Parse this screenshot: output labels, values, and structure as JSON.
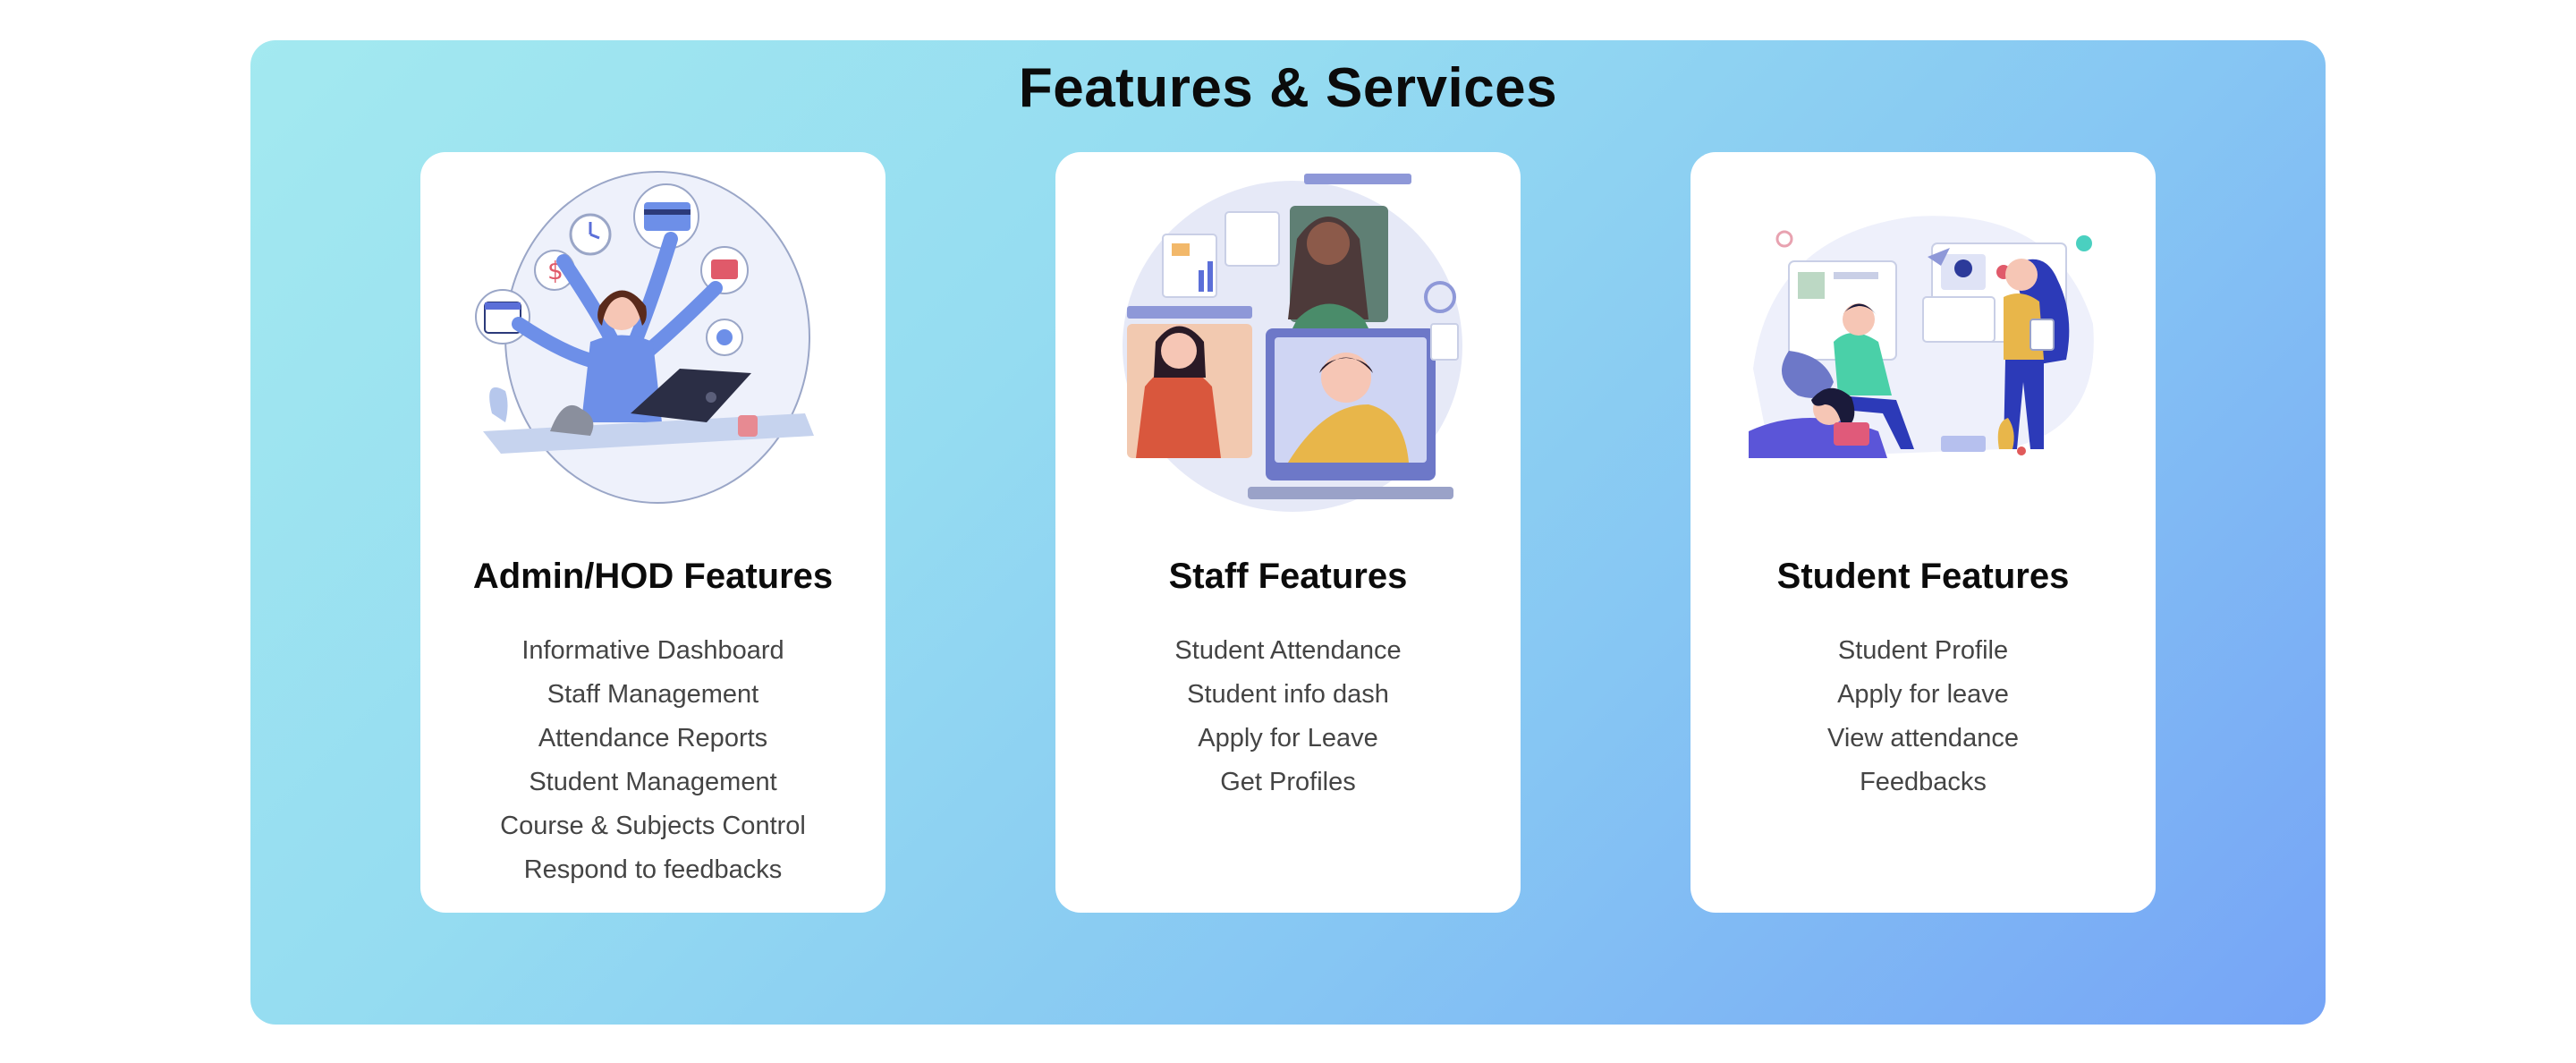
{
  "section": {
    "title": "Features & Services",
    "gradient": [
      "#a3e9f0",
      "#76a4f6"
    ]
  },
  "cards": [
    {
      "title": "Admin/HOD Features",
      "illustration": "multitasking-admin-illustration",
      "items": [
        "Informative Dashboard",
        "Staff Management",
        "Attendance Reports",
        "Student Management",
        "Course & Subjects Control",
        "Respond to feedbacks"
      ]
    },
    {
      "title": "Staff Features",
      "illustration": "staff-collaboration-illustration",
      "items": [
        "Student Attendance",
        "Student info dash",
        "Apply for Leave",
        "Get Profiles"
      ]
    },
    {
      "title": "Student Features",
      "illustration": "student-remote-learning-illustration",
      "items": [
        "Student Profile",
        "Apply for leave",
        "View attendance",
        "Feedbacks"
      ]
    }
  ]
}
